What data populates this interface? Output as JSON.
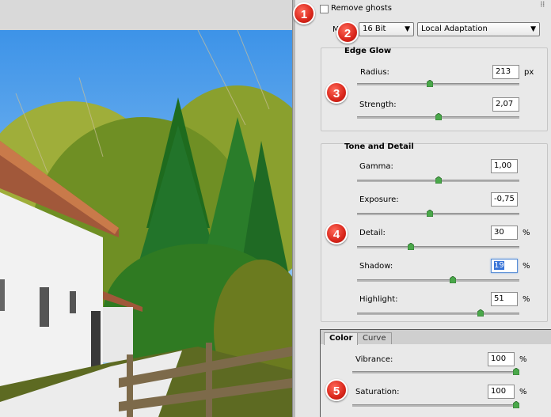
{
  "header": {
    "remove_ghosts_label": "Remove ghosts",
    "remove_ghosts_checked": false
  },
  "mode": {
    "label": "Mode:",
    "bit_depth": "16 Bit",
    "method": "Local Adaptation"
  },
  "edge_glow": {
    "title": "Edge Glow",
    "radius": {
      "label": "Radius:",
      "value": "213",
      "unit": "px",
      "level": 0.45
    },
    "strength": {
      "label": "Strength:",
      "value": "2,07",
      "level": 0.5
    }
  },
  "tone_detail": {
    "title": "Tone and Detail",
    "gamma": {
      "label": "Gamma:",
      "value": "1,00",
      "level": 0.5
    },
    "exposure": {
      "label": "Exposure:",
      "value": "-0,75",
      "level": 0.45
    },
    "detail": {
      "label": "Detail:",
      "value": "30",
      "unit": "%",
      "level": 0.33
    },
    "shadow": {
      "label": "Shadow:",
      "value": "19",
      "unit": "%",
      "level": 0.59
    },
    "highlight": {
      "label": "Highlight:",
      "value": "51",
      "unit": "%",
      "level": 0.76
    }
  },
  "tabs": {
    "color": "Color",
    "curve": "Curve"
  },
  "color": {
    "vibrance": {
      "label": "Vibrance:",
      "value": "100",
      "unit": "%",
      "level": 1.0
    },
    "saturation": {
      "label": "Saturation:",
      "value": "100",
      "unit": "%",
      "level": 1.0
    }
  },
  "markers": [
    "1",
    "2",
    "3",
    "4",
    "5"
  ],
  "icons": {
    "panel_menu": "panel-menu-icon",
    "dropdown_arrow": "triangle-down-icon",
    "slider_thumb": "slider-thumb-icon"
  },
  "colors": {
    "panel_bg": "#e6e6e6",
    "marker_red": "#d9261b",
    "thumb_green": "#4aa84a"
  }
}
